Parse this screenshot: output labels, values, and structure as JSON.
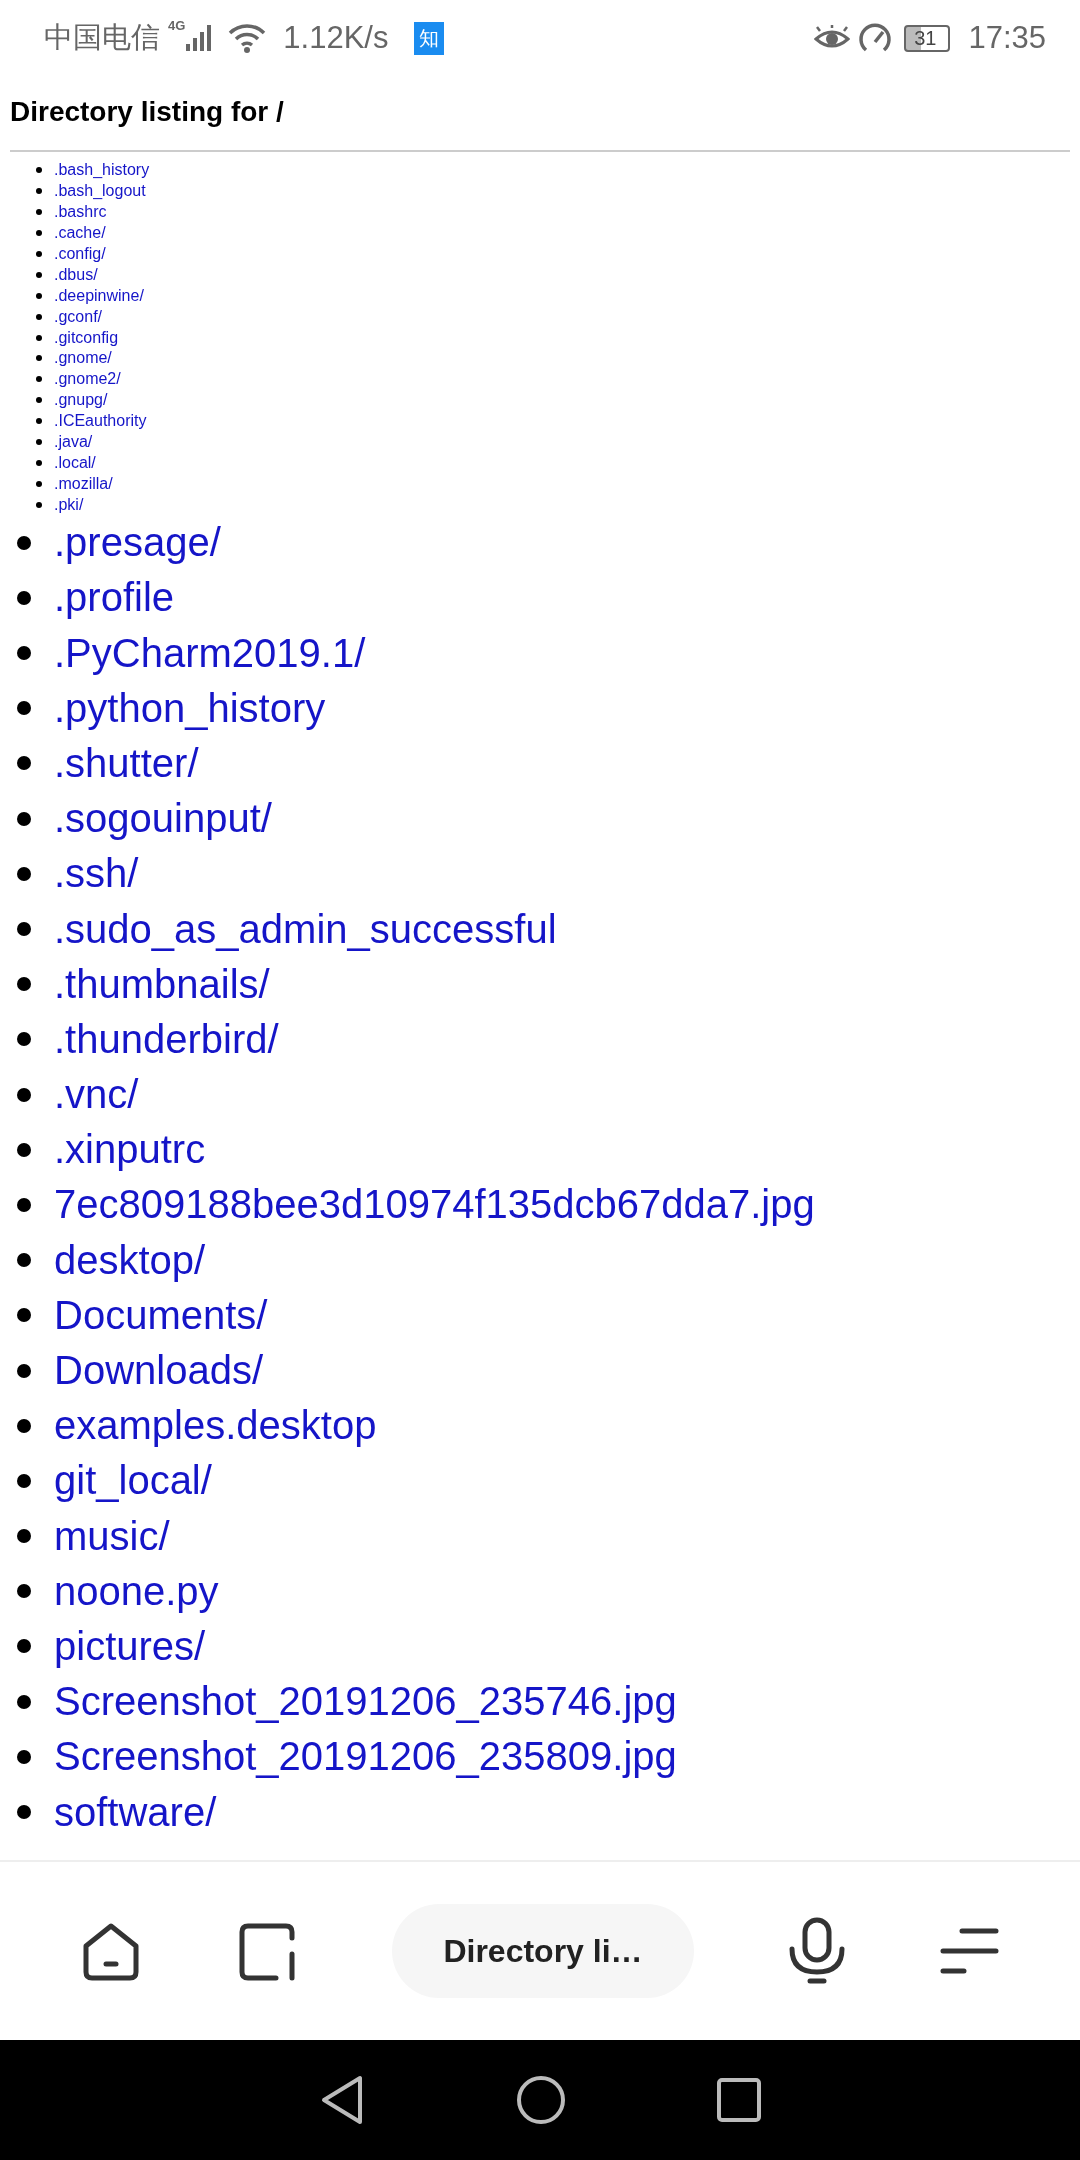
{
  "status_bar": {
    "carrier": "中国电信",
    "network": "4G",
    "speed": "1.12K/s",
    "app_badge": "知",
    "battery": "31",
    "time": "17:35"
  },
  "page": {
    "title": "Directory listing for /",
    "small_entries": [
      ".bash_history",
      ".bash_logout",
      ".bashrc",
      ".cache/",
      ".config/",
      ".dbus/",
      ".deepinwine/",
      ".gconf/",
      ".gitconfig",
      ".gnome/",
      ".gnome2/",
      ".gnupg/",
      ".ICEauthority",
      ".java/",
      ".local/",
      ".mozilla/",
      ".pki/"
    ],
    "entries": [
      ".presage/",
      ".profile",
      ".PyCharm2019.1/",
      ".python_history",
      ".shutter/",
      ".sogouinput/",
      ".ssh/",
      ".sudo_as_admin_successful",
      ".thumbnails/",
      ".thunderbird/",
      ".vnc/",
      ".xinputrc",
      "7ec809188bee3d10974f135dcb67dda7.jpg",
      "desktop/",
      "Documents/",
      "Downloads/",
      "examples.desktop",
      "git_local/",
      "music/",
      "noone.py",
      "pictures/",
      "Screenshot_20191206_235746.jpg",
      "Screenshot_20191206_235809.jpg",
      "software/"
    ]
  },
  "toolbar": {
    "tab_title": "Directory li…"
  }
}
